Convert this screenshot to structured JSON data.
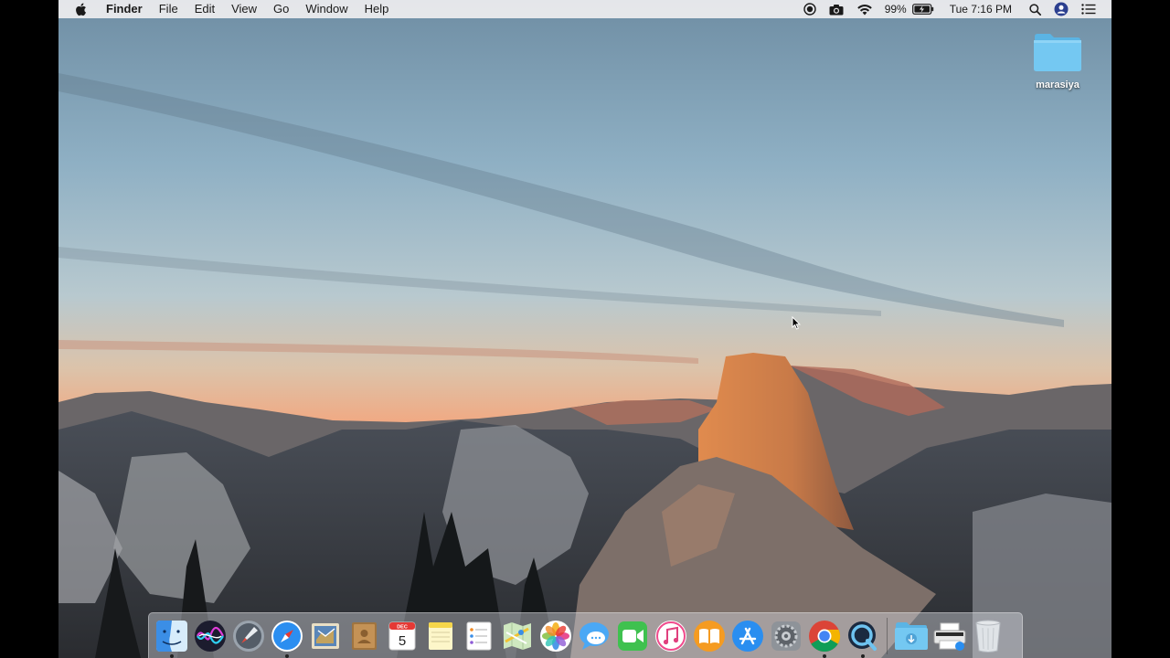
{
  "menubar": {
    "apple_icon": "apple-logo-icon",
    "app_name": "Finder",
    "menus": [
      "File",
      "Edit",
      "View",
      "Go",
      "Window",
      "Help"
    ],
    "battery_percent": "99%",
    "clock": "Tue 7:16 PM",
    "status_icons": [
      "screen-record-icon",
      "screenshot-camera-icon",
      "wifi-icon",
      "battery-charging-icon",
      "spotlight-search-icon",
      "user-avatar-icon",
      "notification-center-icon"
    ]
  },
  "desktop": {
    "folder_label": "marasiya",
    "folder_icon": "folder-icon"
  },
  "dock": {
    "apps": [
      {
        "name": "finder-icon",
        "running": true
      },
      {
        "name": "siri-icon",
        "running": false
      },
      {
        "name": "launchpad-icon",
        "running": false
      },
      {
        "name": "safari-icon",
        "running": true
      },
      {
        "name": "mail-icon",
        "running": false
      },
      {
        "name": "contacts-icon",
        "running": false
      },
      {
        "name": "calendar-icon",
        "running": false
      },
      {
        "name": "notes-icon",
        "running": false
      },
      {
        "name": "reminders-icon",
        "running": false
      },
      {
        "name": "maps-icon",
        "running": false
      },
      {
        "name": "photos-icon",
        "running": false
      },
      {
        "name": "messages-icon",
        "running": false
      },
      {
        "name": "facetime-icon",
        "running": false
      },
      {
        "name": "itunes-icon",
        "running": false
      },
      {
        "name": "ibooks-icon",
        "running": false
      },
      {
        "name": "app-store-icon",
        "running": false
      },
      {
        "name": "system-preferences-icon",
        "running": false
      },
      {
        "name": "chrome-icon",
        "running": true
      },
      {
        "name": "quicktime-icon",
        "running": true
      }
    ],
    "calendar_month": "DEC",
    "calendar_day": "5",
    "stack_items": [
      "downloads-folder-icon",
      "printer-icon",
      "trash-icon"
    ]
  },
  "colors": {
    "menubar_bg": "#ececee",
    "folder_blue": "#6cc6f2",
    "sky_top": "#7e9db2",
    "sunset_orange": "#f2a982"
  }
}
